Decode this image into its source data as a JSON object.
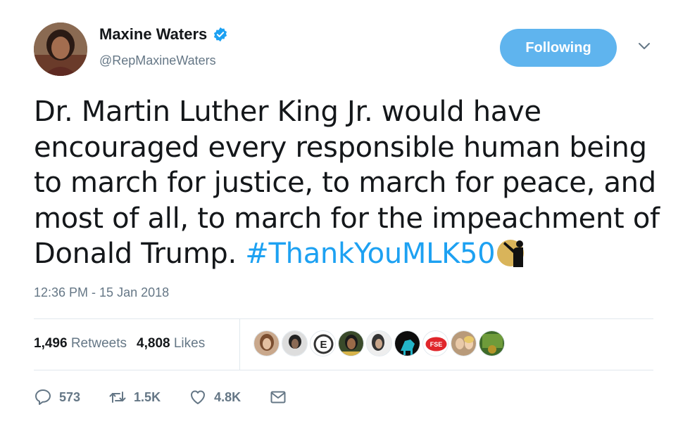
{
  "author": {
    "display_name": "Maxine Waters",
    "handle": "@RepMaxineWaters",
    "verified": true
  },
  "follow_button": {
    "label": "Following"
  },
  "tweet": {
    "text_lines": [
      "Dr. Martin Luther King Jr. would have",
      "encouraged every responsible human being",
      "to march for justice,  to march for peace, and",
      "most of all, to march for the impeachment of"
    ],
    "last_line_text": "Donald Trump. ",
    "hashtag": "#ThankYouMLK50",
    "hashflag_icon": "mlk-silhouette-icon",
    "timestamp": "12:36 PM - 15 Jan 2018"
  },
  "stats": {
    "retweets_count": "1,496",
    "retweets_label": "Retweets",
    "likes_count": "4,808",
    "likes_label": "Likes"
  },
  "likers": [
    "avatar-1",
    "avatar-2",
    "avatar-3",
    "avatar-4",
    "avatar-5",
    "avatar-6",
    "avatar-7",
    "avatar-8",
    "avatar-9"
  ],
  "actions": {
    "reply_count": "573",
    "retweet_count": "1.5K",
    "like_count": "4.8K"
  },
  "colors": {
    "accent": "#1da1f2",
    "follow_bg": "#5fb4ee",
    "muted": "#657786",
    "text": "#14171a"
  }
}
